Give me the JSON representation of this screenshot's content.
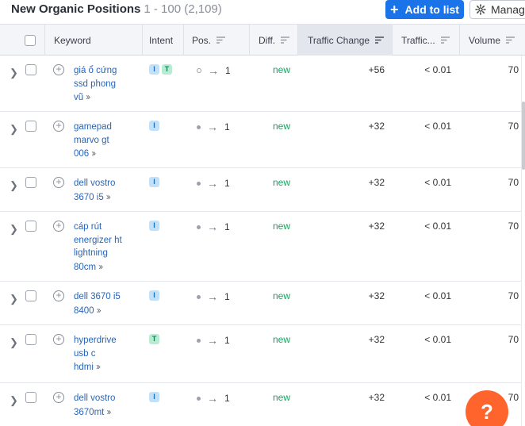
{
  "header": {
    "title": "New Organic Positions",
    "range": "1 - 100 (2,109)",
    "add_to_list_label": "Add to list",
    "manage_label": "Manag"
  },
  "columns": {
    "keyword": "Keyword",
    "intent": "Intent",
    "position": "Pos.",
    "difficulty": "Diff.",
    "traffic_change": "Traffic Change",
    "traffic_share": "Traffic...",
    "volume": "Volume"
  },
  "rows": [
    {
      "keyword_lines": [
        "giá ổ cứng",
        "ssd phong",
        "vũ"
      ],
      "intents": [
        "I",
        "T"
      ],
      "prev_marker": "hollow",
      "position": "1",
      "difficulty": "new",
      "traffic_change": "+56",
      "traffic_share": "< 0.01",
      "volume": "70"
    },
    {
      "keyword_lines": [
        "gamepad",
        "marvo gt",
        "006"
      ],
      "intents": [
        "I"
      ],
      "prev_marker": "dot",
      "position": "1",
      "difficulty": "new",
      "traffic_change": "+32",
      "traffic_share": "< 0.01",
      "volume": "70"
    },
    {
      "keyword_lines": [
        "dell vostro",
        "3670 i5"
      ],
      "intents": [
        "I"
      ],
      "prev_marker": "dot",
      "position": "1",
      "difficulty": "new",
      "traffic_change": "+32",
      "traffic_share": "< 0.01",
      "volume": "70"
    },
    {
      "keyword_lines": [
        "cáp rút",
        "energizer ht",
        "lightning",
        "80cm"
      ],
      "intents": [
        "I"
      ],
      "prev_marker": "dot",
      "position": "1",
      "difficulty": "new",
      "traffic_change": "+32",
      "traffic_share": "< 0.01",
      "volume": "70"
    },
    {
      "keyword_lines": [
        "dell 3670 i5",
        "8400"
      ],
      "intents": [
        "I"
      ],
      "prev_marker": "dot",
      "position": "1",
      "difficulty": "new",
      "traffic_change": "+32",
      "traffic_share": "< 0.01",
      "volume": "70"
    },
    {
      "keyword_lines": [
        "hyperdrive",
        "usb c",
        "hdmi"
      ],
      "intents": [
        "T"
      ],
      "prev_marker": "dot",
      "position": "1",
      "difficulty": "new",
      "traffic_change": "+32",
      "traffic_share": "< 0.01",
      "volume": "70"
    },
    {
      "keyword_lines": [
        "dell vostro",
        "3670mt"
      ],
      "intents": [
        "I"
      ],
      "prev_marker": "dot",
      "position": "1",
      "difficulty": "new",
      "traffic_change": "+32",
      "traffic_share": "< 0.01",
      "volume": "70"
    }
  ],
  "icons": {
    "expand": "chevron-right-icon",
    "add_keyword": "plus-circle-icon",
    "more": "double-chevron-right-icon",
    "arrow": "arrow-right-icon",
    "sort": "sort-icon",
    "settings": "gear-icon",
    "help": "question-icon"
  },
  "help_label": "?",
  "colors": {
    "accent": "#1a73e8",
    "link": "#2965b8",
    "new": "#1e9e5f",
    "help": "#ff642d",
    "intent_informational": "#c2e1f9",
    "intent_transactional": "#b7ecd2"
  }
}
